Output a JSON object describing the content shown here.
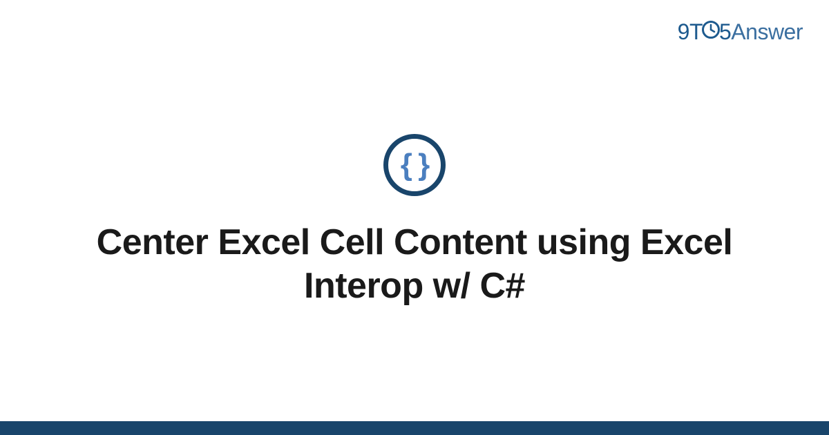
{
  "brand": {
    "prefix_nine": "9",
    "t": "T",
    "five": "5",
    "answer": "Answer"
  },
  "icon": {
    "glyph": "{ }",
    "name": "code-braces-icon"
  },
  "title": "Center Excel Cell Content using Excel Interop w/ C#",
  "colors": {
    "dark_blue": "#19456b",
    "brand_blue": "#1d5a8e",
    "brace_blue": "#4b7fbf"
  }
}
